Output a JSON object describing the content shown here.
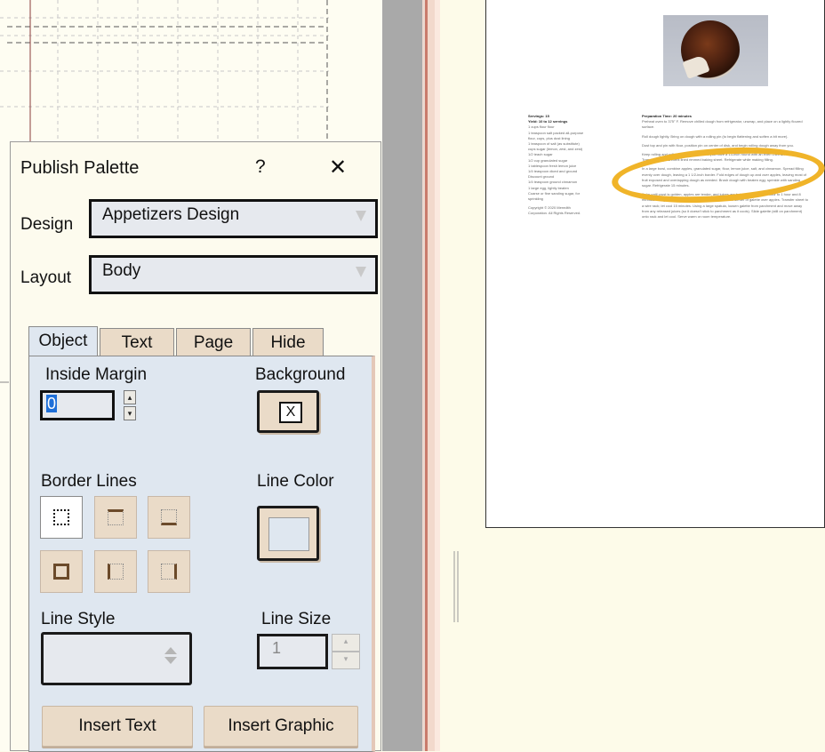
{
  "palette": {
    "title": "Publish Palette",
    "help": "?",
    "close": "✕",
    "design_label": "Design",
    "design_value": "Appetizers Design",
    "layout_label": "Layout",
    "layout_value": "Body",
    "tabs": [
      "Object",
      "Text",
      "Page",
      "Hide"
    ],
    "active_tab": "Object",
    "inside_margin_label": "Inside Margin",
    "inside_margin_value": "0",
    "background_label": "Background",
    "background_button_glyph": "X",
    "border_lines_label": "Border Lines",
    "line_color_label": "Line Color",
    "line_style_label": "Line Style",
    "line_size_label": "Line Size",
    "line_size_value": "1",
    "insert_text": "Insert Text",
    "insert_graphic": "Insert Graphic",
    "border_options": [
      "dotted-all",
      "top",
      "bottom",
      "all",
      "left-right-dotted",
      "right"
    ]
  },
  "document": {
    "left_column": [
      "Servings: 15",
      "Yield: 10 to 12 servings",
      "1 cups flour flour",
      "1 teaspoon salt packed all-purpose",
      "flour, cups, plus dust lining",
      "1 teaspoon of salt (as substitute)",
      "cups sugar (lemon, zest, and zest)",
      "1/2 teach sugar",
      "1/2 cup granulated sugar",
      "1 tablespoon fresh lemon juice",
      "1/4 teaspoon diced and ground",
      "Discount ground",
      "1/4 teaspoon ground cinnamon",
      "1 large egg, lightly beaten",
      "Coarse or fine sanding sugar, for",
      "sprinkling",
      "Copyright © 2020 Meredith",
      "Corporation. All Rights Reserved."
    ],
    "right_column": [
      "Preparation Time: 20 minutes",
      "Preheat oven to 375° F. Remove chilled dough from refrigerator, unwrap, and place on a lightly floured surface.",
      "Roll dough lightly. Bring on dough with a rolling pin (to begin flattening and soften a bit more).",
      "Dust top and pin with flour, position pin on center of disk, and begin rolling dough away from you.",
      "Keep rolling and rolling to this manner until you have a 13-inch round with an even 1/8-inch thickness. Transfer to a parchment lined rimmed baking sheet. Refrigerate while making filling.",
      "In a large bowl, combine apples, granulated sugar, flour, lemon juice, salt, and cinnamon. Spread filling evenly over dough, leaving a 1 1/2-inch border. Fold edges of dough up and over apples, leaving most of fruit exposed and overlapping dough as needed. Brush dough with beaten egg; sprinkle with sanding sugar. Refrigerate 15 minutes.",
      "Bake until crust is golden, apples are tender, and juices are bubbling in center, 1 hour to 1 hour and 8 minutes. Using a pastry brush, spread some of juices from center of galette over apples. Transfer sheet to a wire rack; let cool 15 minutes. Using a large spatula, loosen galette from parchment and move away from any released juices (so it doesn't stick to parchment as it cools). Slide galette (still on parchment) onto rack and let cool. Serve warm or room temperature."
    ]
  },
  "colors": {
    "highlight": "#f0b429",
    "tab_panel": "#dfe7f0",
    "button": "#eadbc8",
    "selection": "#1f6fd8"
  }
}
